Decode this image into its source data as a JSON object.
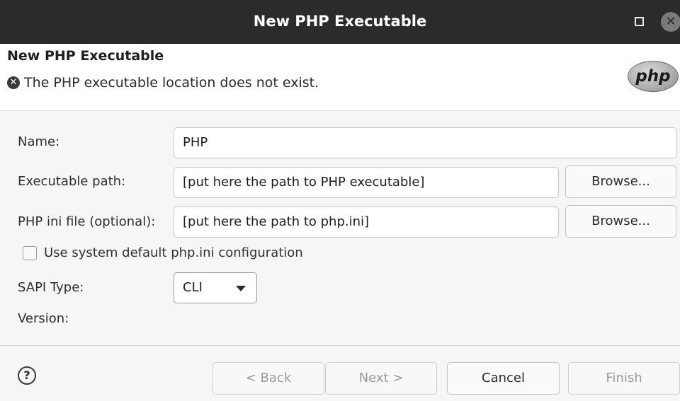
{
  "window": {
    "title": "New PHP Executable",
    "maximize_icon": "maximize-icon",
    "close_icon": "close-icon"
  },
  "header": {
    "title": "New PHP Executable",
    "message": "The PHP executable location does not exist.",
    "error_icon": "error-icon",
    "logo": "php"
  },
  "form": {
    "name_label": "Name:",
    "name_value": "PHP",
    "exec_label": "Executable path:",
    "exec_value": "[put here the path to PHP executable]",
    "ini_label": "PHP ini file (optional):",
    "ini_value": "[put here the path to php.ini]",
    "browse_label": "Browse...",
    "use_default_label": "Use system default php.ini configuration",
    "use_default_checked": false,
    "sapi_label": "SAPI Type:",
    "sapi_value": "CLI",
    "version_label": "Version:"
  },
  "footer": {
    "help_icon": "help-icon",
    "back_label": "< Back",
    "next_label": "Next >",
    "cancel_label": "Cancel",
    "finish_label": "Finish"
  }
}
